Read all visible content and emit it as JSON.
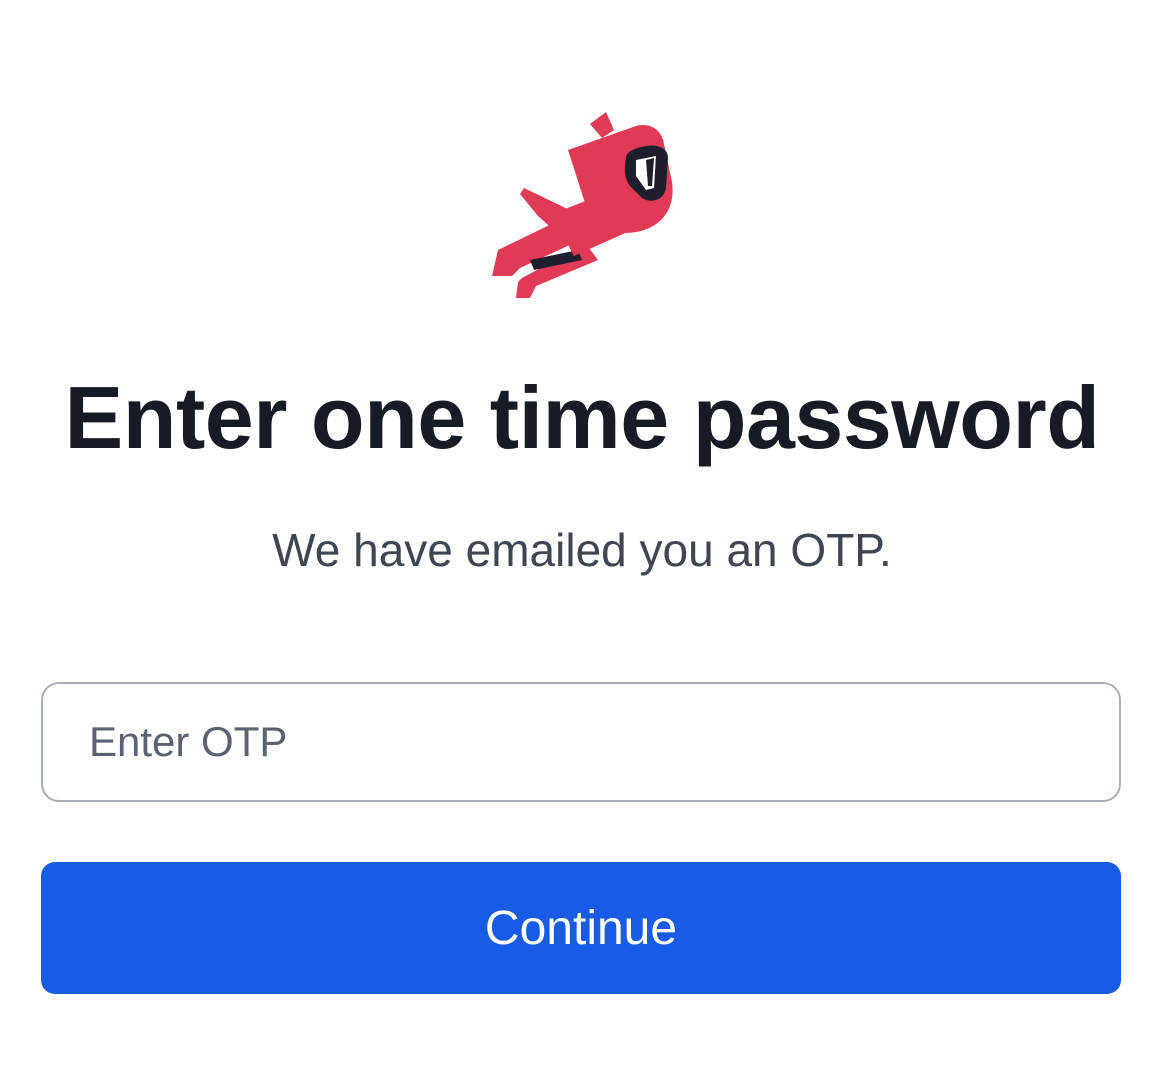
{
  "logo": {
    "icon": "flying-ninja-icon",
    "colors": {
      "body": "#e03a57",
      "dark": "#1d1f2e",
      "eye": "#ffffff"
    }
  },
  "heading": {
    "title": "Enter one time password",
    "subtitle": "We have emailed you an OTP."
  },
  "form": {
    "otp_value": "",
    "otp_placeholder": "Enter OTP",
    "continue_label": "Continue"
  },
  "colors": {
    "primary": "#175be6",
    "title_text": "#161b26",
    "subtitle_text": "#3f4652",
    "input_border": "#a9adb8"
  }
}
